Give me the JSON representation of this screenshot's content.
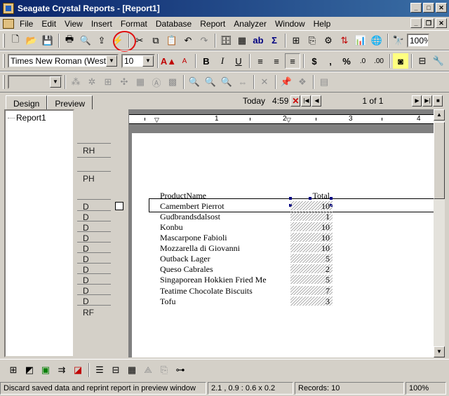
{
  "window": {
    "title": "Seagate Crystal Reports - [Report1]"
  },
  "menu": [
    "File",
    "Edit",
    "View",
    "Insert",
    "Format",
    "Database",
    "Report",
    "Analyzer",
    "Window",
    "Help"
  ],
  "toolbar": {
    "zoom_value": "100%"
  },
  "format_bar": {
    "font_name": "Times New Roman (Western)",
    "font_size": "10"
  },
  "tabs": {
    "design": "Design",
    "preview": "Preview"
  },
  "preview_nav": {
    "today_label": "Today",
    "time": "4:59",
    "page_indicator": "1 of 1"
  },
  "tree": {
    "root": "Report1"
  },
  "sections": {
    "rh": "RH",
    "ph": "PH",
    "d": "D",
    "rf": "RF"
  },
  "ruler": {
    "marks": [
      "1",
      "2",
      "3",
      "4"
    ]
  },
  "report": {
    "col_product": "ProductName",
    "col_total": "Total",
    "rows": [
      {
        "name": "Camembert Pierrot",
        "total": "10"
      },
      {
        "name": "Gudbrandsdalsost",
        "total": "1"
      },
      {
        "name": "Konbu",
        "total": "10"
      },
      {
        "name": "Mascarpone Fabioli",
        "total": "10"
      },
      {
        "name": "Mozzarella di Giovanni",
        "total": "10"
      },
      {
        "name": "Outback Lager",
        "total": "5"
      },
      {
        "name": "Queso Cabrales",
        "total": "2"
      },
      {
        "name": "Singaporean Hokkien Fried Me",
        "total": "5"
      },
      {
        "name": "Teatime Chocolate Biscuits",
        "total": "7"
      },
      {
        "name": "Tofu",
        "total": "3"
      }
    ]
  },
  "status": {
    "message": "Discard saved data and reprint report in preview window",
    "position": "2.1 , 0.9 : 0.6 x 0.2",
    "records": "Records:  10",
    "zoom": "100%"
  }
}
